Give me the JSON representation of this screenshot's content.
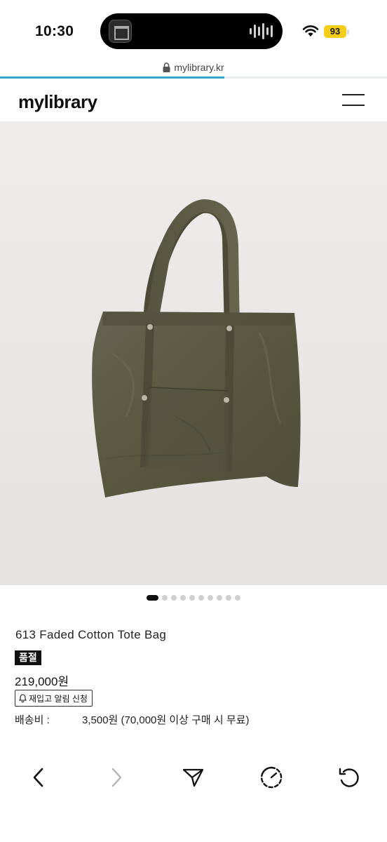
{
  "status_bar": {
    "time": "10:30",
    "battery": "93",
    "icons": [
      "island-media-thumbnail",
      "audio-waveform-icon",
      "wifi-icon",
      "battery-icon"
    ]
  },
  "browser": {
    "url": "mylibrary.kr",
    "load_progress": 0.58,
    "icons": [
      "lock-icon"
    ]
  },
  "header": {
    "logo": "mylibrary",
    "icons": [
      "hamburger-menu-icon"
    ]
  },
  "gallery": {
    "image_count": 10,
    "active_index": 0,
    "image_subject": "olive tote bag photo"
  },
  "product": {
    "name": "613 Faded Cotton Tote Bag",
    "badge": "품절",
    "price": "219,000원",
    "notify_button": "재입고 알림 신청",
    "shipping_label": "배송비 :",
    "shipping_value": "3,500원 (70,000원 이상 구매 시 무료)"
  },
  "toolbar": {
    "icons": [
      "back-arrow-icon",
      "forward-arrow-icon",
      "share-send-icon",
      "speed-dial-icon",
      "reload-icon"
    ]
  },
  "colors": {
    "progress": "#37a6c9",
    "battery": "#f4cd18",
    "badge_bg": "#111111",
    "bag": "#5a5a45"
  }
}
